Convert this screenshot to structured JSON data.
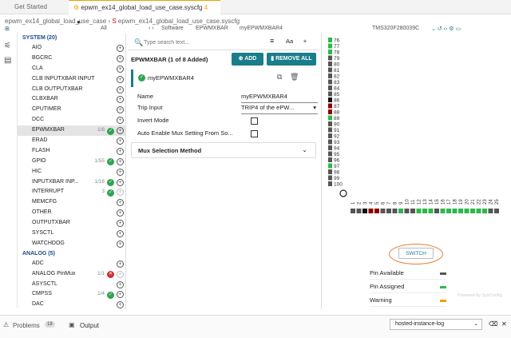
{
  "tabs": [
    {
      "label": "Get Started"
    },
    {
      "label": "epwm_ex14_global_load_use_case.syscfg",
      "badge": "4"
    }
  ],
  "breadcrumb": {
    "project": "epwm_ex14_global_load_use_case",
    "file": "epwm_ex14_global_load_use_case.syscfg",
    "section": "Software",
    "module": "EPWMXBAR",
    "instance": "myEPWMXBAR4",
    "device": "TMS320F280039C"
  },
  "toolbar": {
    "all_label": "All"
  },
  "categories": [
    {
      "label": "SYSTEM (20)",
      "items": [
        {
          "label": "AIO"
        },
        {
          "label": "BGCRC"
        },
        {
          "label": "CLA"
        },
        {
          "label": "CLB INPUTXBAR INPUT"
        },
        {
          "label": "CLB OUTPUTXBAR"
        },
        {
          "label": "CLBXBAR"
        },
        {
          "label": "CPUTIMER"
        },
        {
          "label": "DCC"
        },
        {
          "label": "EPWMXBAR",
          "count": "1/8",
          "status": "ok",
          "selected": true
        },
        {
          "label": "ERAD"
        },
        {
          "label": "FLASH"
        },
        {
          "label": "GPIO",
          "count": "1/55",
          "status": "ok"
        },
        {
          "label": "HIC"
        },
        {
          "label": "INPUTXBAR INP...",
          "count": "1/16",
          "status": "ok"
        },
        {
          "label": "INTERRUPT",
          "count": "3",
          "status": "ok",
          "disabled": true
        },
        {
          "label": "MEMCFG"
        },
        {
          "label": "OTHER"
        },
        {
          "label": "OUTPUTXBAR"
        },
        {
          "label": "SYSCTL"
        },
        {
          "label": "WATCHDOG"
        }
      ]
    },
    {
      "label": "ANALOG (5)",
      "items": [
        {
          "label": "ADC"
        },
        {
          "label": "ANALOG PinMux",
          "count": "1/1",
          "status": "error",
          "disabled": true
        },
        {
          "label": "ASYSCTL"
        },
        {
          "label": "CMPSS",
          "count": "1/4",
          "status": "ok"
        },
        {
          "label": "DAC"
        }
      ]
    }
  ],
  "panel": {
    "search_placeholder": "Type search text...",
    "aa_label": "Aa",
    "title": "EPWMXBAR (1 of 8 Added)",
    "add_label": "ADD",
    "remove_all_label": "REMOVE ALL",
    "instance_name": "myEPWMXBAR4",
    "fields": {
      "name_label": "Name",
      "name_value": "myEPWMXBAR4",
      "trip_label": "Trip Input",
      "trip_value": "TRIP4 of the ePW...",
      "invert_label": "Invert Mode",
      "auto_label": "Auto Enable Mux Setting From So..."
    },
    "mux_label": "Mux Selection Method"
  },
  "pins": {
    "numbers": [
      "76",
      "77",
      "78",
      "79",
      "80",
      "81",
      "82",
      "83",
      "84",
      "85",
      "86",
      "87",
      "88",
      "89",
      "90",
      "91",
      "92",
      "93",
      "94",
      "95",
      "96",
      "97",
      "98",
      "99",
      "100"
    ],
    "colors": [
      "#2db84d",
      "#2db84d",
      "#2db84d",
      "#555555",
      "#555555",
      "#555555",
      "#555555",
      "#555555",
      "#555555",
      "#555555",
      "#111111",
      "#8b0000",
      "#8b0000",
      "#2db84d",
      "#555555",
      "#555555",
      "#555555",
      "#555555",
      "#555555",
      "#555555",
      "#555555",
      "#2db84d",
      "#555555",
      "#555555",
      "#555555"
    ],
    "bottom_numbers": [
      "1",
      "2",
      "3",
      "4",
      "5",
      "6",
      "7",
      "8",
      "9",
      "10",
      "11",
      "12",
      "13",
      "14",
      "15",
      "16",
      "17",
      "18",
      "19",
      "20",
      "21",
      "22",
      "23",
      "24",
      "25"
    ],
    "bottom_colors": [
      "#555555",
      "#555555",
      "#111111",
      "#8b0000",
      "#8b0000",
      "#555555",
      "#555555",
      "#555555",
      "#2db84d",
      "#555555",
      "#555555",
      "#2db84d",
      "#2db84d",
      "#2db84d",
      "#555555",
      "#2db84d",
      "#2db84d",
      "#2db84d",
      "#2db84d",
      "#2db84d",
      "#2db84d",
      "#2db84d",
      "#2db84d",
      "#555555",
      "#555555"
    ],
    "switch_label": "SWITCH",
    "legend": [
      {
        "label": "Pin Available",
        "color": "#555555"
      },
      {
        "label": "Pin Assigned",
        "color": "#2db84d"
      },
      {
        "label": "Warning",
        "color": "#f0a000"
      }
    ],
    "watermark": "Powered by SysConfig"
  },
  "bottom": {
    "problems_label": "Problems",
    "problems_count": "18",
    "output_label": "Output",
    "log_select": "hosted-instance-log"
  }
}
